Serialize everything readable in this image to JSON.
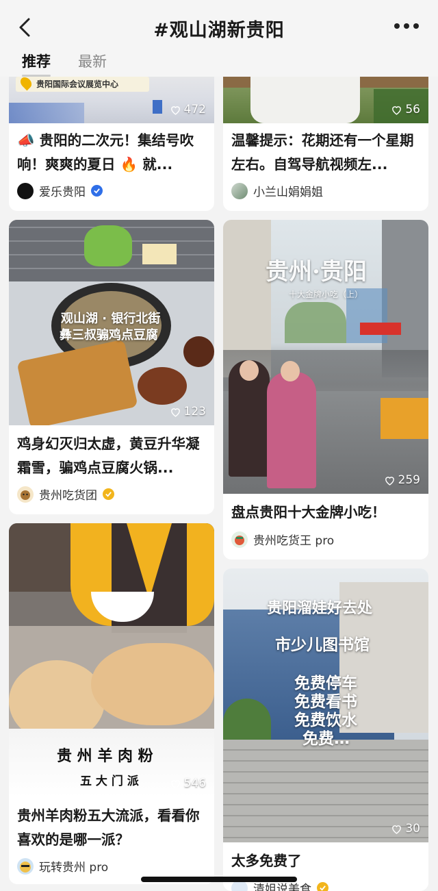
{
  "header": {
    "title": "#观山湖新贵阳",
    "tabs": [
      "推荐",
      "最新"
    ]
  },
  "cards": [
    {
      "title": "📣 贵阳的二次元！集结号吹响！爽爽的夏日 🔥 就...",
      "likes": "472",
      "author": "爱乐贵阳",
      "verified": "blue",
      "overlay": [
        "贵阳国际会议展览中心"
      ]
    },
    {
      "title": "温馨提示：花期还有一个星期左右。自驾导航视频左...",
      "likes": "56",
      "author": "小兰山娟娟姐",
      "verified": "",
      "overlay": []
    },
    {
      "title": "鸡身幻灭归太虚，黄豆升华凝霜雪，骗鸡点豆腐火锅...",
      "likes": "123",
      "author": "贵州吃货团",
      "verified": "gold",
      "overlay": [
        "观山湖 · 银行北街",
        "彝三叔骟鸡点豆腐"
      ]
    },
    {
      "title": "盘点贵阳十大金牌小吃！",
      "likes": "259",
      "author": "贵州吃货王 pro",
      "verified": "",
      "overlay": [
        "贵州·贵阳",
        "十大金牌小吃（上）"
      ]
    },
    {
      "title": "贵州羊肉粉五大流派，看看你喜欢的是哪一派？",
      "likes": "546",
      "author": "玩转贵州 pro",
      "verified": "",
      "overlay": [
        "贵 州 羊 肉 粉",
        "五 大 门 派"
      ]
    },
    {
      "title": "太多免费了",
      "likes": "30",
      "author": "清姐说美食",
      "verified": "gold",
      "overlay": [
        "贵阳溜娃好去处",
        "市少儿图书馆",
        "免费停车",
        "免费看书",
        "免费饮水",
        "免费…"
      ]
    }
  ],
  "colors": {
    "blue_badge": "#2f6fe8",
    "gold_badge": "#f2b51c"
  }
}
